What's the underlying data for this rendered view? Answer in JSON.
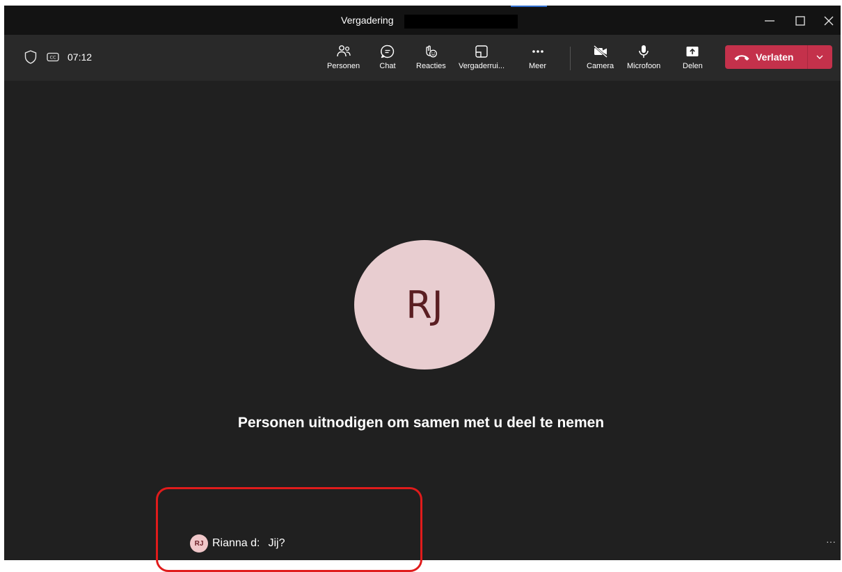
{
  "window": {
    "title": "Vergadering"
  },
  "toolbar": {
    "timer": "07:12",
    "buttons": [
      {
        "label": "Personen",
        "icon": "people-icon"
      },
      {
        "label": "Chat",
        "icon": "chat-icon"
      },
      {
        "label": "Reacties",
        "icon": "reactions-icon"
      },
      {
        "label": "Vergaderrui...",
        "icon": "meeting-rooms-icon"
      },
      {
        "label": "Meer",
        "icon": "more-icon"
      },
      {
        "label": "Camera",
        "icon": "camera-off-icon"
      },
      {
        "label": "Microfoon",
        "icon": "microphone-icon"
      },
      {
        "label": "Delen",
        "icon": "share-icon"
      }
    ],
    "leave_label": "Verlaten"
  },
  "stage": {
    "avatar_initials": "RJ",
    "invite_text": "Personen uitnodigen om samen met u deel te nemen"
  },
  "chat_bubble": {
    "initials": "RJ",
    "sender": "Rianna d:",
    "message": "Jij?"
  },
  "colors": {
    "background": "#202020",
    "toolbar": "#292929",
    "leave_button": "#c4314b",
    "avatar": "#e8cdd0",
    "highlight": "#e01b1b"
  }
}
